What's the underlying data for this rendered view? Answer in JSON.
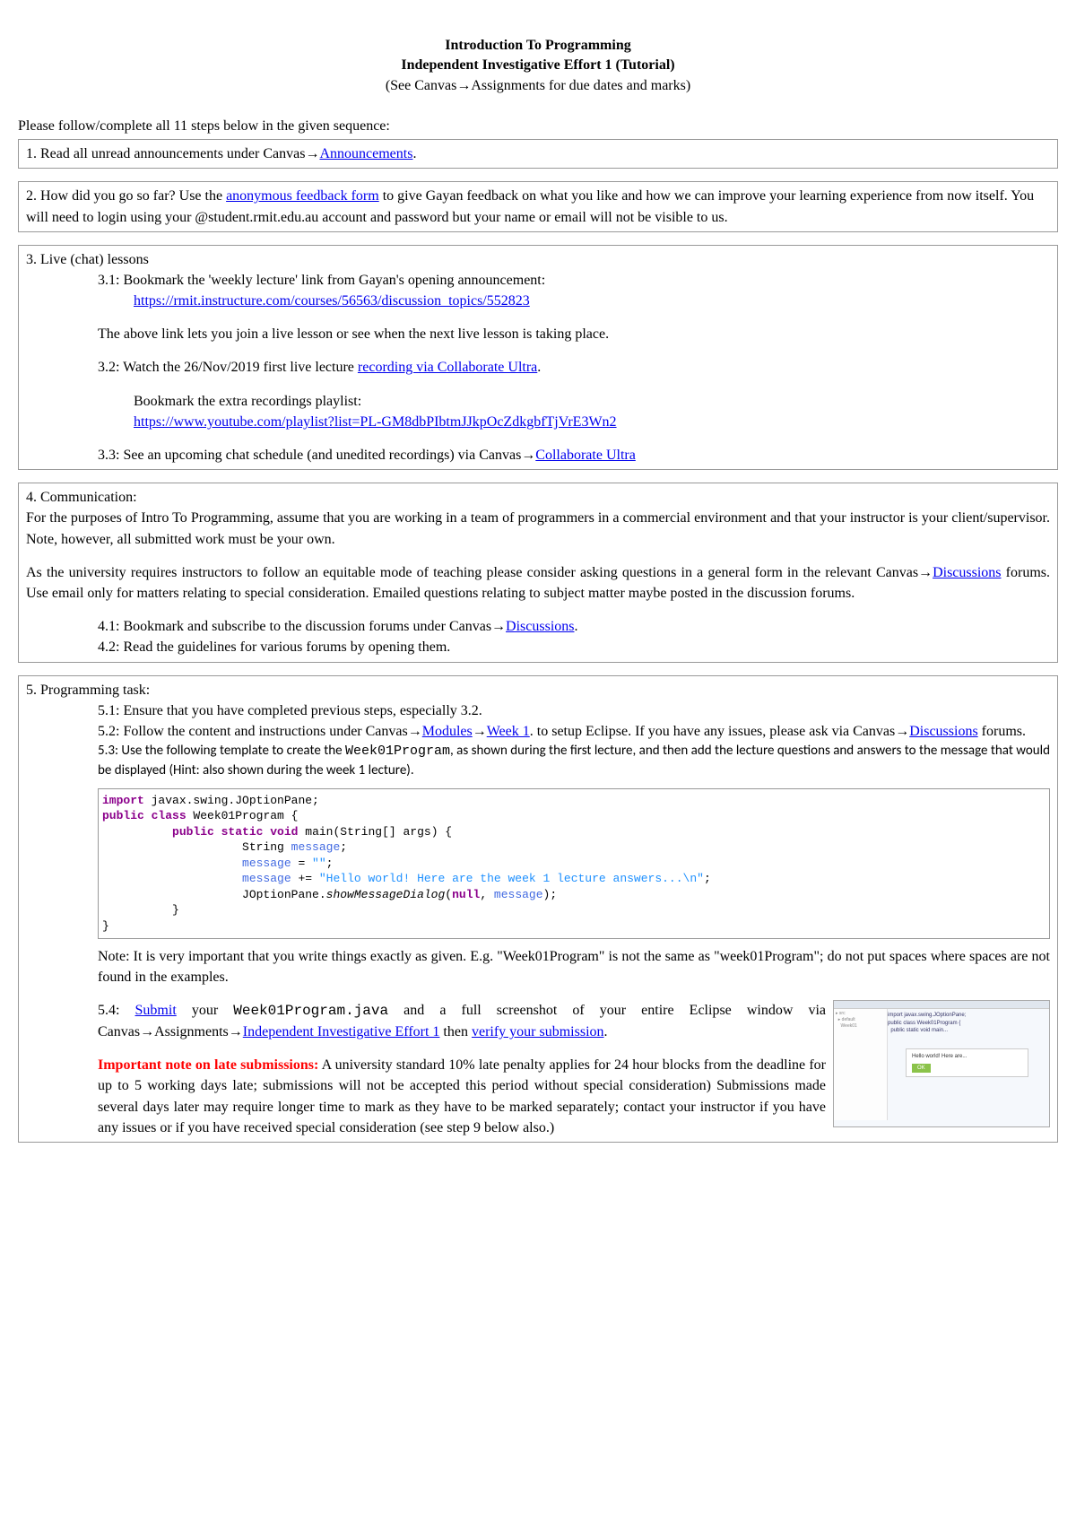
{
  "header": {
    "title1": "Introduction To Programming",
    "title2": "Independent Investigative Effort 1 (Tutorial)",
    "subtitle": "(See Canvas→Assignments for due dates and marks)"
  },
  "intro": "Please follow/complete all 11 steps below in the given sequence:",
  "step1": {
    "prefix": "1. Read all unread announcements under Canvas→",
    "link": "Announcements",
    "suffix": "."
  },
  "step2": {
    "p1a": "2. How did you go so far? Use the ",
    "link": "anonymous feedback form",
    "p1b": " to give Gayan feedback on what you like and how we can improve your learning experience from now itself. You will need to login using your @student.rmit.edu.au account and password but your name or email will not be visible to us."
  },
  "step3": {
    "title": "3. Live (chat) lessons",
    "s31": "3.1: Bookmark the 'weekly lecture' link from Gayan's opening announcement:",
    "s31link": "https://rmit.instructure.com/courses/56563/discussion_topics/552823",
    "s31note": "The above link lets you join a live lesson or see when the next live lesson is taking place.",
    "s32a": "3.2: Watch the 26/Nov/2019 first live lecture ",
    "s32link": "recording via Collaborate Ultra",
    "s32b": ".",
    "s32extra": "Bookmark the extra recordings playlist:",
    "s32playlist": "https://www.youtube.com/playlist?list=PL-GM8dbPIbtmJJkpOcZdkgbfTjVrE3Wn2",
    "s33a": "3.3: See an upcoming chat schedule (and unedited recordings) via Canvas→",
    "s33link": "Collaborate Ultra"
  },
  "step4": {
    "title": "4. Communication:",
    "p1": "For the purposes of Intro To Programming, assume that you are working in a team of programmers in a commercial environment and that your instructor is your client/supervisor. Note, however, all submitted work must be your own.",
    "p2a": "As the university requires instructors to follow an equitable mode of teaching please consider asking questions in a general form in the relevant Canvas→",
    "p2link": "Discussions",
    "p2b": " forums. Use email only for matters relating to special consideration. Emailed questions relating to subject matter maybe posted in the discussion forums.",
    "s41a": "4.1: Bookmark and subscribe to the discussion forums under Canvas→",
    "s41link": "Discussions",
    "s41b": ".",
    "s42": "4.2: Read the guidelines for various forums by opening them."
  },
  "step5": {
    "title": "5. Programming task:",
    "s51": "5.1: Ensure that you have completed previous steps, especially 3.2.",
    "s52a": "5.2: Follow the content and instructions under Canvas→",
    "s52link1": "Modules",
    "s52mid": "→",
    "s52link2": "Week 1",
    "s52b": ". to setup Eclipse. If you have any issues, please ask via Canvas→",
    "s52link3": "Discussions",
    "s52c": " forums.",
    "s53a": "5.3: Use the following template to create the ",
    "s53prog": "Week01Program",
    "s53b": ", as shown during the first lecture, and then add the lecture questions and answers to the message that would be displayed (Hint: also shown during the week 1 lecture).",
    "note": "Note: It is very important that you write things exactly as given. E.g. \"Week01Program\" is not the same as \"week01Program\"; do not put spaces where spaces are not found in the examples.",
    "s54a": "5.4: ",
    "s54submit": "Submit",
    "s54b": " your ",
    "s54file": "Week01Program.java",
    "s54c": " and a full screenshot of your entire Eclipse window via Canvas→Assignments→",
    "s54link1": "Independent Investigative Effort 1",
    "s54d": " then ",
    "s54link2": "verify your submission",
    "s54e": ".",
    "lateTitle": "Important note on late submissions:",
    "lateBody": " A university standard 10% late penalty applies for 24 hour blocks from the deadline for up to 5 working days late; submissions will not be accepted this period without special consideration) Submissions made several days later may require longer time to mark as they have to be marked separately; contact your instructor if you have any issues or if you have received special consideration (see step 9 below also.)"
  },
  "code": {
    "l1a": "import",
    "l1b": " javax.swing.JOptionPane;",
    "l2a": "public class",
    "l2b": " Week01Program {",
    "l3a": "public static",
    "l3b": " ",
    "l3c": "void",
    "l3d": " main(String[] args) {",
    "l4a": "String ",
    "l4b": "message",
    "l4c": ";",
    "l5a": "message",
    "l5b": " = ",
    "l5c": "\"\"",
    "l5d": ";",
    "l6a": "message",
    "l6b": " += ",
    "l6c": "\"Hello world! Here are the week 1 lecture answers...\\n\"",
    "l6d": ";",
    "l7a": "JOptionPane.",
    "l7b": "showMessageDialog",
    "l7c": "(",
    "l7d": "null",
    "l7e": ", ",
    "l7f": "message",
    "l7g": ");",
    "l8": "}",
    "l9": "}"
  }
}
